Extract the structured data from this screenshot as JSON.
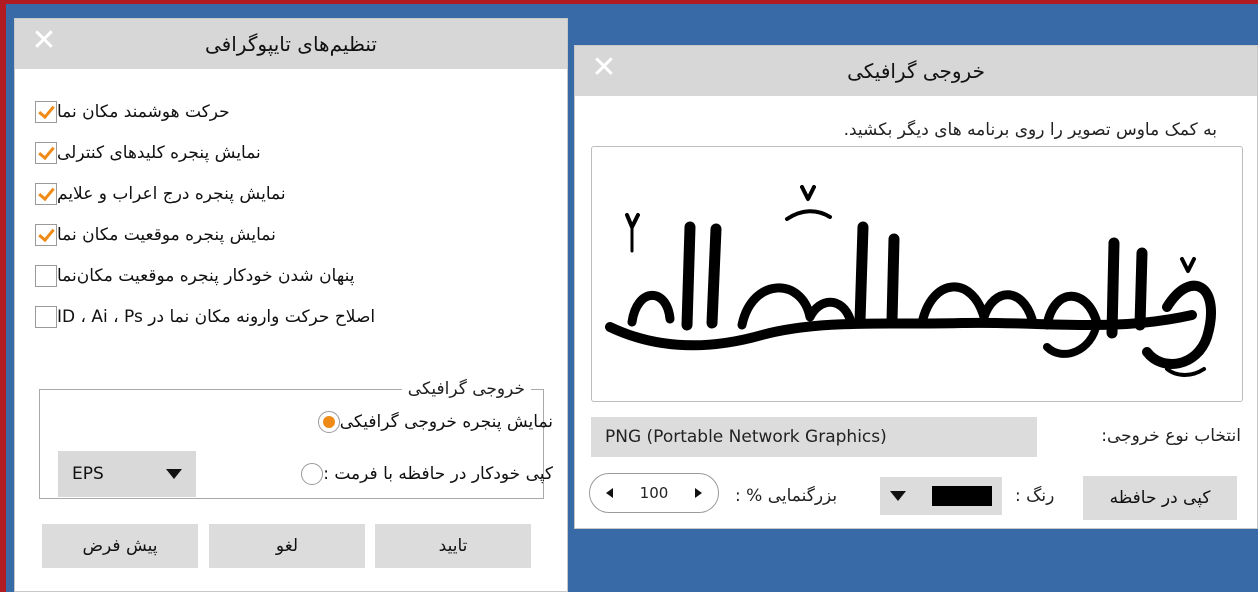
{
  "typography_dialog": {
    "title": "تنظیم‌های تایپوگرافی",
    "checkboxes": [
      {
        "label": "حرکت هوشمند مکان نما",
        "checked": true
      },
      {
        "label": "نمایش پنجره کلیدهای کنترلی",
        "checked": true
      },
      {
        "label": "نمایش پنجره درج اعراب و علایم",
        "checked": true
      },
      {
        "label": "نمایش پنجره موقعیت مکان نما",
        "checked": true
      },
      {
        "label": "پنهان شدن خودکار پنجره موقعیت مکان‌نما",
        "checked": false
      },
      {
        "label": "اصلاح حرکت وارونه مکان نما در ID ، Ai ، Ps",
        "checked": false
      }
    ],
    "graphic_group": {
      "legend": "خروجی گرافیکی",
      "radio_show_window": "نمایش پنجره خروجی گرافیکی",
      "radio_auto_copy": "کپی خودکار در حافظه با فرمت :",
      "selected": "show_window",
      "format_value": "EPS"
    },
    "buttons": {
      "ok": "تایید",
      "cancel": "لغو",
      "default": "پیش فرض"
    }
  },
  "graphic_dialog": {
    "title": "خروجی گرافیکی",
    "hint": "به کمک ماوس تصویر را روی برنامه های دیگر بکشید.",
    "preview_text": "وعلیکم السلام",
    "output_type_label": "انتخاب نوع خروجی:",
    "output_type_value": "PNG (Portable Network Graphics)",
    "copy_button": "کپی در حافظه",
    "color_label": "رنگ :",
    "color_value": "#000000",
    "zoom_label": "بزرگنمایی % :",
    "zoom_value": "100"
  },
  "colors": {
    "accent": "#f08a17",
    "desktop": "#376aa6",
    "titlebar": "#d7d7d7"
  },
  "icons": {
    "close": "close-icon",
    "dropdown": "chevron-down-icon",
    "zoom_dec": "arrow-left-icon",
    "zoom_inc": "arrow-right-icon"
  }
}
